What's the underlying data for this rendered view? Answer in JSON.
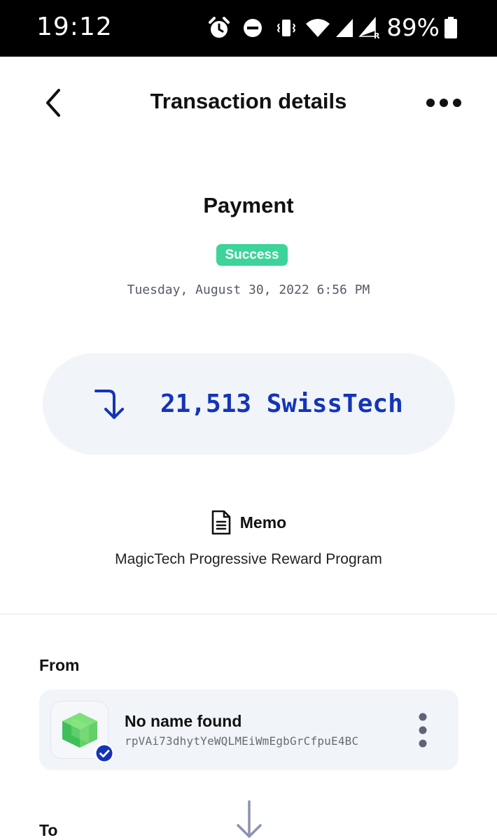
{
  "status_bar": {
    "time": "19:12",
    "battery_percent": "89%",
    "icons": [
      "alarm-icon",
      "do-not-disturb-icon",
      "vibrate-icon",
      "wifi-icon",
      "signal-icon",
      "signal-roaming-icon",
      "battery-icon"
    ]
  },
  "header": {
    "title": "Transaction details",
    "back_icon": "chevron-left-icon",
    "more_icon": "more-horizontal-icon"
  },
  "transaction": {
    "type": "Payment",
    "status": "Success",
    "date": "Tuesday, August 30, 2022 6:56 PM",
    "amount": "21,513 SwissTech",
    "direction_icon": "incoming-arrow-icon"
  },
  "memo": {
    "label": "Memo",
    "text": "MagicTech Progressive Reward Program"
  },
  "from": {
    "label": "From",
    "account_name": "No name found",
    "account_address": "rpVAi73dhytYeWQLMEiWmEgbGrCfpuE4BC"
  },
  "to": {
    "label": "To"
  },
  "colors": {
    "accent_blue": "#1434b8",
    "success_green": "#3cd49a",
    "card_background": "#f1f4f9"
  }
}
